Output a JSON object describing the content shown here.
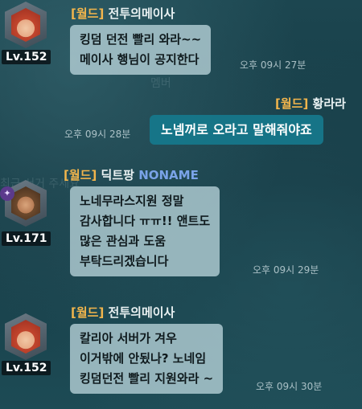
{
  "background_hints": {
    "members": "멤버",
    "blurred": "최근 서거 주세요"
  },
  "messages": [
    {
      "channel": "[월드]",
      "sender": "전투의메이사",
      "level": "Lv.152",
      "lines": [
        "킹덤 던전 빨리 와라~~",
        "메이사 행님이 공지한다"
      ],
      "time": "오후 09시 27분"
    },
    {
      "channel": "[월드]",
      "sender": "황라라",
      "lines": [
        "노넴꺼로 오라고 말해줘야죠"
      ],
      "time": "오후 09시 28분"
    },
    {
      "channel": "[월드]",
      "sender": "딕트팡",
      "guild": "NONAME",
      "level": "Lv.171",
      "badge": "✦",
      "lines": [
        "노네무라스지원 정말",
        "감사합니다 ㅠㅠ!! 앤트도",
        "많은 관심과 도움",
        "부탁드리겠습니다"
      ],
      "time": "오후 09시 29분"
    },
    {
      "channel": "[월드]",
      "sender": "전투의메이사",
      "level": "Lv.152",
      "lines": [
        "칼리아 서버가 겨우",
        "이거밖에 안됬나? 노네임",
        "킹덤던전 빨리 지원와라 ~"
      ],
      "time": "오후 09시 30분"
    }
  ],
  "colors": {
    "channel_tag": "#f2b54c",
    "guild_name": "#7aa3e8",
    "my_bubble": "#1678aa"
  }
}
